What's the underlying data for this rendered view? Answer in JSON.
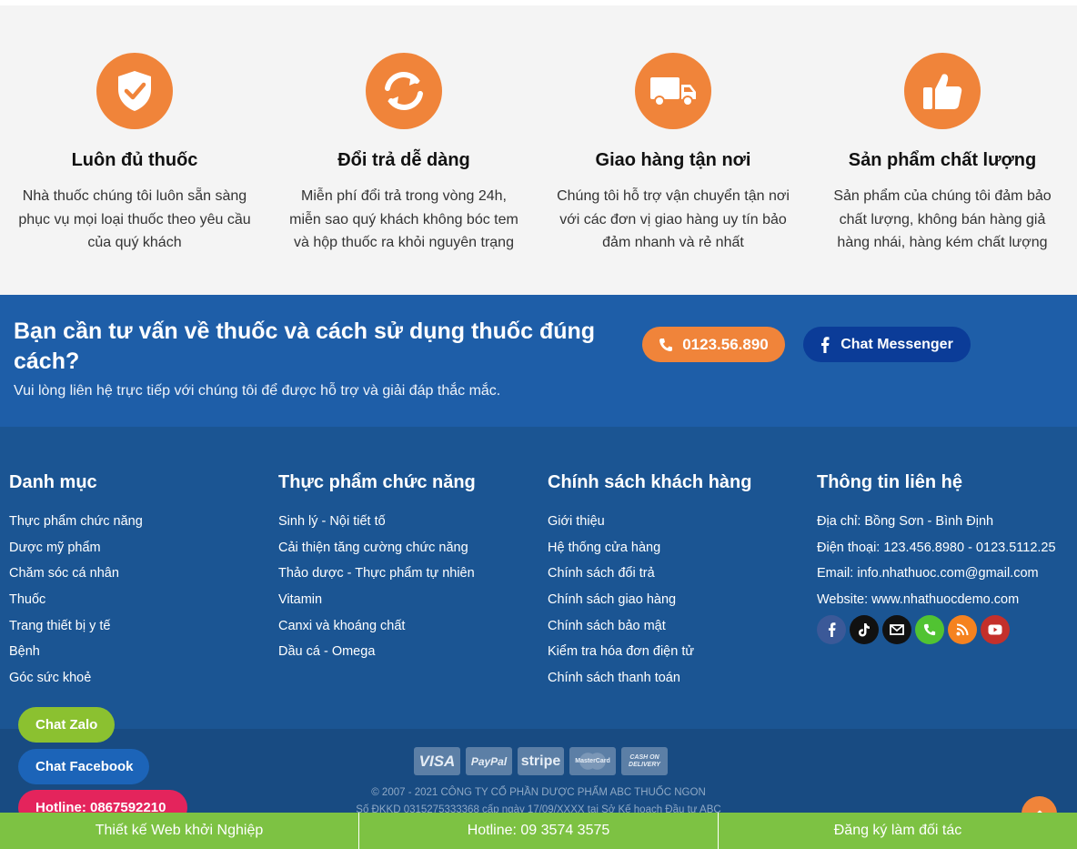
{
  "features": [
    {
      "icon": "shield-check-icon",
      "title": "Luôn đủ thuốc",
      "text": "Nhà thuốc chúng tôi luôn sẵn sàng phục vụ mọi loại thuốc theo yêu cầu của quý khách"
    },
    {
      "icon": "refresh-icon",
      "title": "Đổi trả dễ dàng",
      "text": "Miễn phí đổi trả trong vòng 24h, miễn sao quý khách không bóc tem và hộp thuốc ra khỏi nguyên trạng"
    },
    {
      "icon": "truck-icon",
      "title": "Giao hàng tận nơi",
      "text": "Chúng tôi hỗ trợ vận chuyển tận nơi với các đơn vị giao hàng uy tín bảo đảm nhanh và rẻ nhất"
    },
    {
      "icon": "thumbs-up-icon",
      "title": "Sản phẩm chất lượng",
      "text": "Sản phẩm của chúng tôi đảm bảo chất lượng, không bán hàng giả hàng nhái, hàng kém chất lượng"
    }
  ],
  "cta": {
    "heading": "Bạn cần tư vấn về thuốc và cách sử dụng thuốc đúng cách?",
    "subtext": "Vui lòng liên hệ trực tiếp với chúng tôi để được hỗ trợ và giải đáp thắc mắc.",
    "phone_label": "0123.56.890",
    "messenger_label": "Chat Messenger"
  },
  "footer": {
    "col1": {
      "title": "Danh mục",
      "items": [
        "Thực phẩm chức năng",
        "Dược mỹ phẩm",
        "Chăm sóc cá nhân",
        "Thuốc",
        "Trang thiết bị y tế",
        "Bệnh",
        "Góc sức khoẻ"
      ]
    },
    "col2": {
      "title": "Thực phẩm chức năng",
      "items": [
        "Sinh lý - Nội tiết tố",
        "Cải thiện tăng cường chức năng",
        "Thảo dược - Thực phẩm tự nhiên",
        "Vitamin",
        "Canxi và khoáng chất",
        "Dầu cá - Omega"
      ]
    },
    "col3": {
      "title": "Chính sách khách hàng",
      "items": [
        "Giới thiệu",
        "Hệ thống cửa hàng",
        "Chính sách đổi trả",
        "Chính sách giao hàng",
        "Chính sách bảo mật",
        "Kiểm tra hóa đơn điện tử",
        "Chính sách thanh toán"
      ]
    },
    "col4": {
      "title": "Thông tin liên hệ",
      "items": [
        "Địa chỉ: Bồng Sơn - Bình Định",
        "Điện thoại: 123.456.8980 - 0123.5112.25",
        "Email: info.nhathuoc.com@gmail.com",
        "Website: www.nhathuocdemo.com"
      ]
    },
    "social": [
      {
        "icon": "facebook-icon",
        "color": "#3b5998"
      },
      {
        "icon": "tiktok-icon",
        "color": "#111111"
      },
      {
        "icon": "email-icon",
        "color": "#111111"
      },
      {
        "icon": "phone-icon",
        "color": "#51c332"
      },
      {
        "icon": "rss-icon",
        "color": "#f5821f"
      },
      {
        "icon": "youtube-icon",
        "color": "#c4302b"
      }
    ]
  },
  "payments": [
    "VISA",
    "PayPal",
    "stripe",
    "MasterCard",
    "CASH ON DELIVERY"
  ],
  "copyright": {
    "line1": "© 2007 - 2021 CÔNG TY CỔ PHẦN DƯỢC PHẨM ABC THUỐC NGON",
    "line2": "Số ĐKKD 0315275333368 cấp ngày 17/09/XXXX tại Sở Kế hoạch Đầu tư ABC"
  },
  "floating": {
    "zalo": "Chat Zalo",
    "facebook": "Chat Facebook",
    "hotline": "Hotline: 0867592210"
  },
  "bottom_bar": [
    "Thiết kế Web khởi Nghiệp",
    "Hotline: 09 3574 3575",
    "Đăng ký làm đối tác"
  ],
  "colors": {
    "accent": "#f0843a",
    "cta_bg": "#1e5ea8",
    "footer_bg": "#1b5593",
    "bar_green": "#7dc243"
  }
}
